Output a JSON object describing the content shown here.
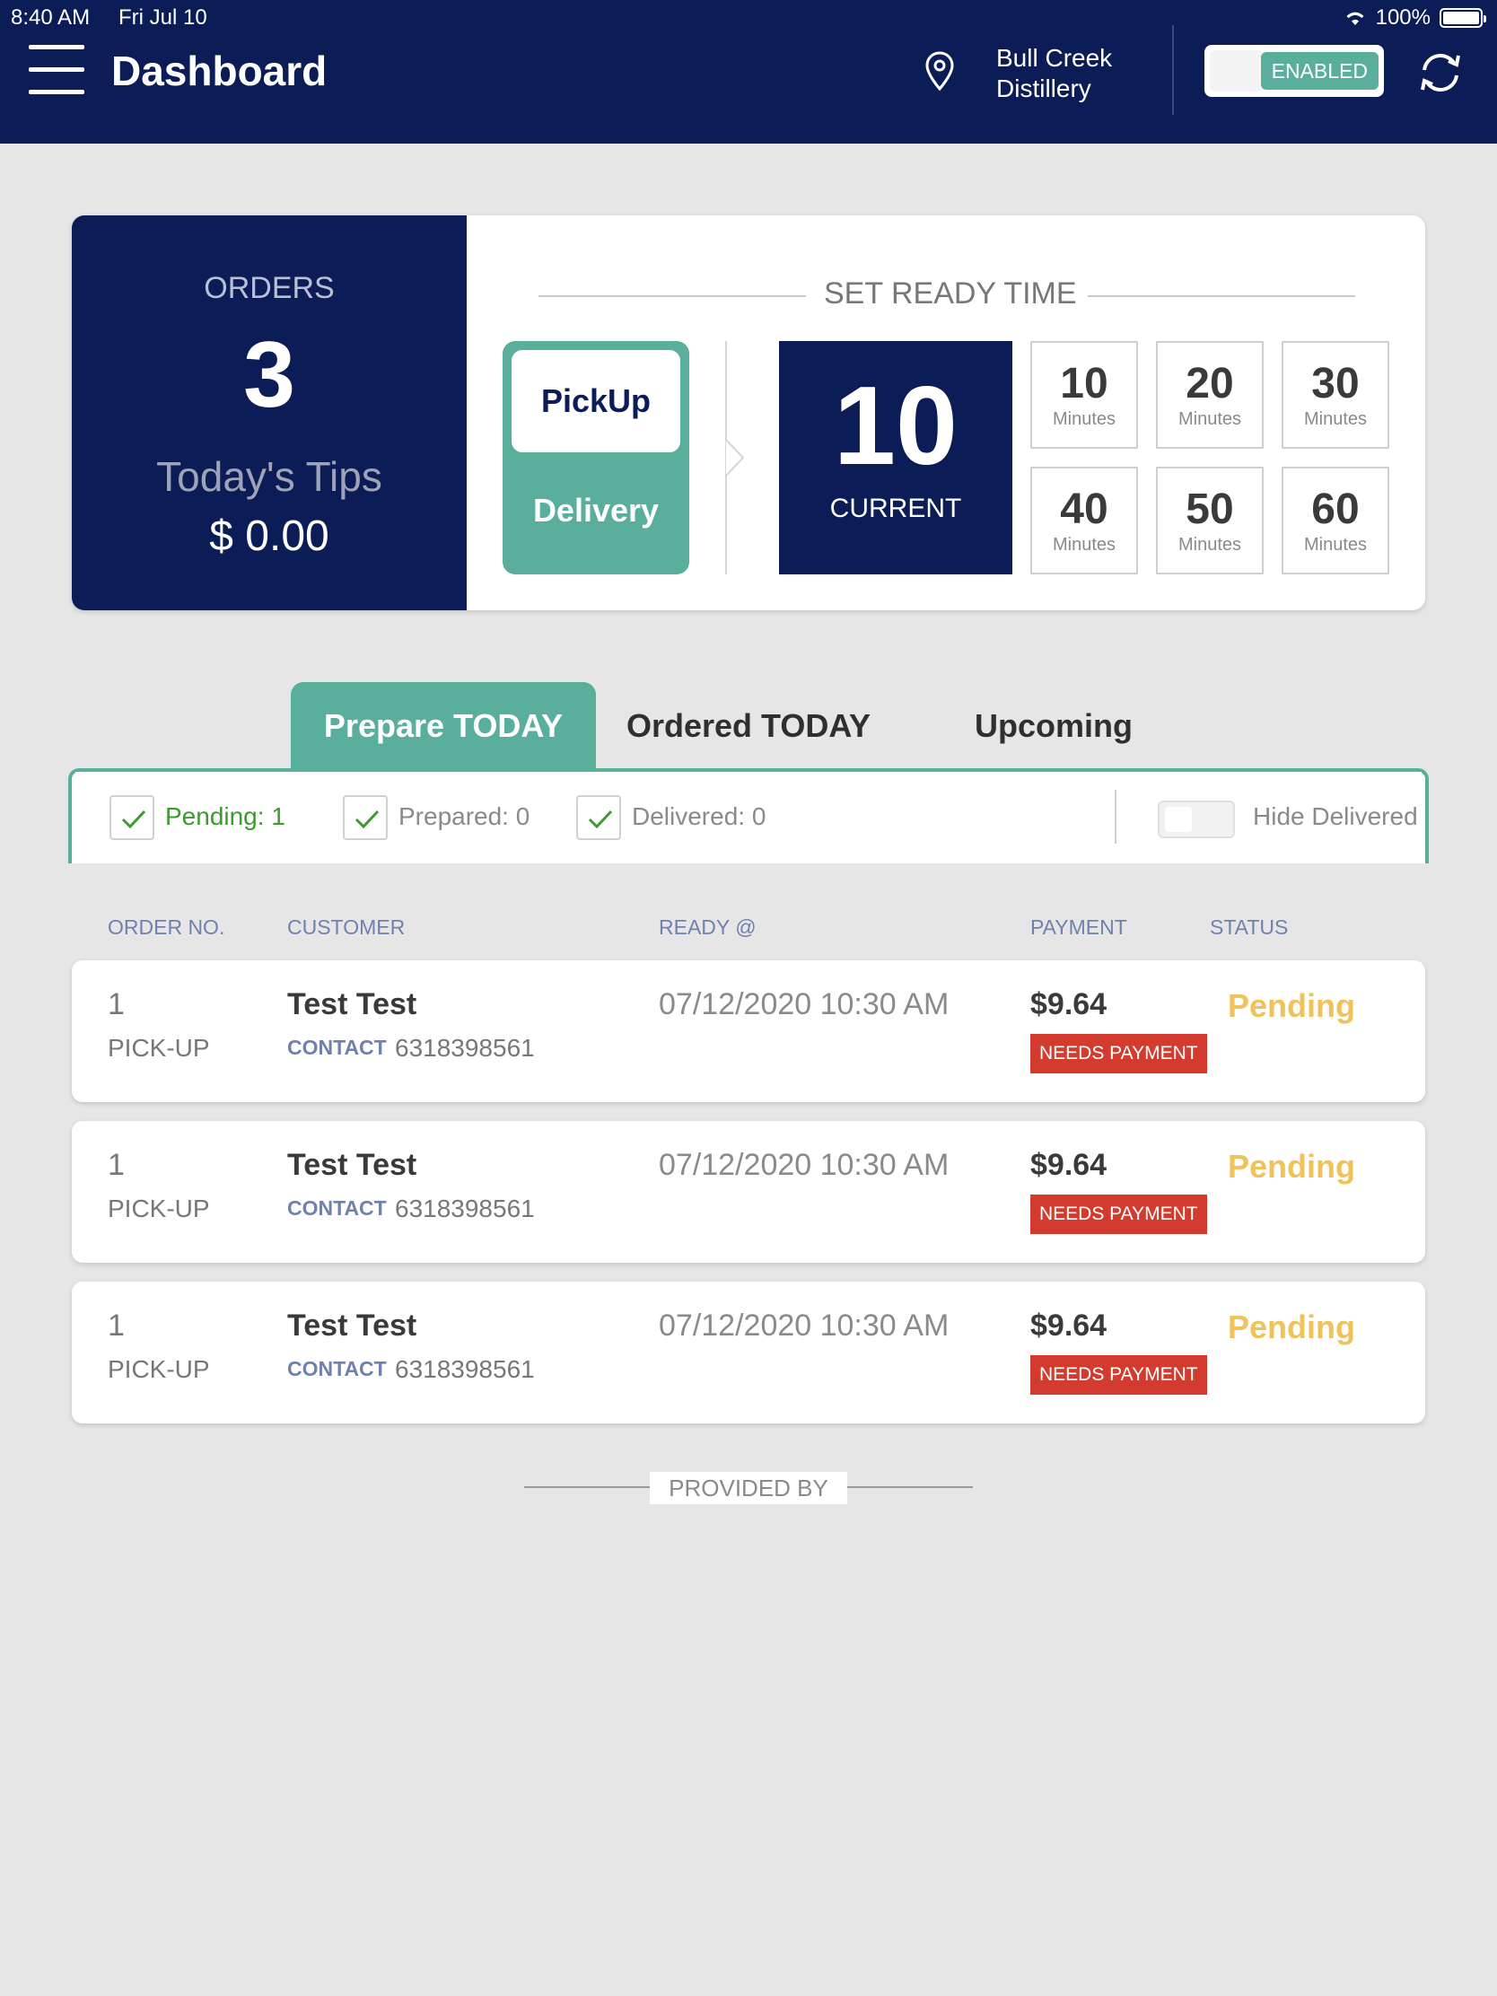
{
  "status_bar": {
    "time": "8:40 AM",
    "date": "Fri Jul 10",
    "battery": "100%"
  },
  "header": {
    "title": "Dashboard",
    "location_line1": "Bull Creek",
    "location_line2": "Distillery",
    "toggle_label": "ENABLED"
  },
  "summary": {
    "orders_label": "ORDERS",
    "orders_count": "3",
    "tips_label": "Today's Tips",
    "tips_value": "$ 0.00"
  },
  "ready_time": {
    "title": "SET READY TIME",
    "method_selected": "PickUp",
    "method_other": "Delivery",
    "current_value": "10",
    "current_label": "CURRENT",
    "options": [
      {
        "value": "10",
        "unit": "Minutes"
      },
      {
        "value": "20",
        "unit": "Minutes"
      },
      {
        "value": "30",
        "unit": "Minutes"
      },
      {
        "value": "40",
        "unit": "Minutes"
      },
      {
        "value": "50",
        "unit": "Minutes"
      },
      {
        "value": "60",
        "unit": "Minutes"
      }
    ]
  },
  "tabs": [
    {
      "label": "Prepare TODAY",
      "active": true
    },
    {
      "label": "Ordered TODAY",
      "active": false
    },
    {
      "label": "Upcoming",
      "active": false
    }
  ],
  "filters": {
    "pending": "Pending: 1",
    "prepared": "Prepared: 0",
    "delivered": "Delivered: 0",
    "hide_delivered": "Hide Delivered"
  },
  "table": {
    "columns": [
      "ORDER NO.",
      "CUSTOMER",
      "READY @",
      "PAYMENT",
      "STATUS"
    ],
    "rows": [
      {
        "order_no": "1",
        "type": "PICK-UP",
        "customer": "Test Test",
        "contact_label": "CONTACT",
        "phone": "6318398561",
        "ready": "07/12/2020 10:30 AM",
        "amount": "$9.64",
        "payment_status": "NEEDS PAYMENT",
        "status": "Pending"
      },
      {
        "order_no": "1",
        "type": "PICK-UP",
        "customer": "Test Test",
        "contact_label": "CONTACT",
        "phone": "6318398561",
        "ready": "07/12/2020 10:30 AM",
        "amount": "$9.64",
        "payment_status": "NEEDS PAYMENT",
        "status": "Pending"
      },
      {
        "order_no": "1",
        "type": "PICK-UP",
        "customer": "Test Test",
        "contact_label": "CONTACT",
        "phone": "6318398561",
        "ready": "07/12/2020 10:30 AM",
        "amount": "$9.64",
        "payment_status": "NEEDS PAYMENT",
        "status": "Pending"
      }
    ]
  },
  "footer": {
    "provided_by": "PROVIDED BY"
  },
  "colors": {
    "navy": "#0c1c57",
    "teal": "#5aaf9c",
    "pending_yellow": "#f0c25a",
    "payment_red": "#d23b2d",
    "check_green": "#3c9a2f"
  }
}
